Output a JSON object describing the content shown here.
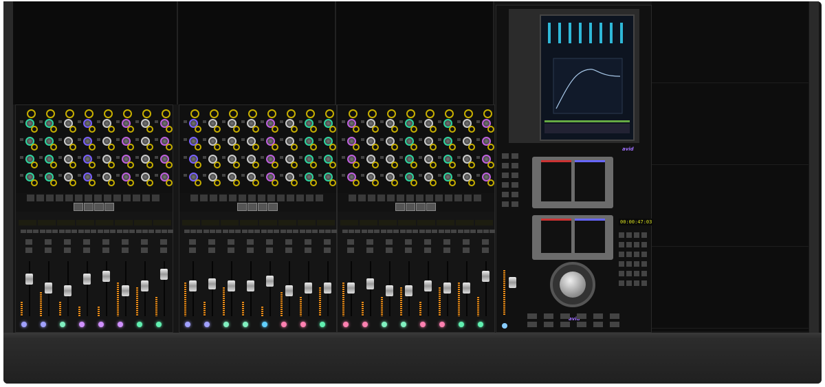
{
  "console": {
    "brand_logo": "avid",
    "timecode": "00:00:47:03",
    "modules": [
      {
        "ring_colors": [
          "#2fd6a0",
          "#2fd6a0",
          "#cccccc",
          "#7a60ff",
          "#cccccc",
          "#c060e0",
          "#cccccc",
          "#c060e0"
        ],
        "select_colors": [
          "#a0a0ff",
          "#a0a0ff",
          "#80f0c0",
          "#d090ff",
          "#d090ff",
          "#d090ff",
          "#60f0b0",
          "#60f0b0"
        ],
        "fader_levels": [
          0.75,
          0.55,
          0.5,
          0.75,
          0.8,
          0.5,
          0.6,
          0.85
        ],
        "meter_levels": [
          0.3,
          0.5,
          0.3,
          0.2,
          0.2,
          0.7,
          0.6,
          0.4
        ]
      },
      {
        "ring_colors": [
          "#7a60ff",
          "#cccccc",
          "#cccccc",
          "#cccccc",
          "#c060e0",
          "#cccccc",
          "#2fd6a0",
          "#2fd6a0"
        ],
        "select_colors": [
          "#a0a0ff",
          "#a0a0ff",
          "#80f0c0",
          "#80f0c0",
          "#60d0ff",
          "#ff80b0",
          "#ff80b0",
          "#60f0b0"
        ],
        "fader_levels": [
          0.6,
          0.65,
          0.6,
          0.6,
          0.7,
          0.5,
          0.55,
          0.55
        ],
        "meter_levels": [
          0.7,
          0.3,
          0.6,
          0.3,
          0.2,
          0.5,
          0.4,
          0.6
        ]
      },
      {
        "ring_colors": [
          "#c060e0",
          "#cccccc",
          "#cccccc",
          "#2fd6a0",
          "#cccccc",
          "#2fd6a0",
          "#cccccc",
          "#c060e0"
        ],
        "select_colors": [
          "#ff80b0",
          "#ff80b0",
          "#80f0c0",
          "#80f0c0",
          "#ff80b0",
          "#ff80b0",
          "#60f0b0",
          "#60f0b0"
        ],
        "fader_levels": [
          0.55,
          0.65,
          0.5,
          0.5,
          0.6,
          0.55,
          0.55,
          0.8
        ],
        "meter_levels": [
          0.7,
          0.3,
          0.4,
          0.6,
          0.3,
          0.6,
          0.7,
          0.4
        ]
      }
    ]
  }
}
